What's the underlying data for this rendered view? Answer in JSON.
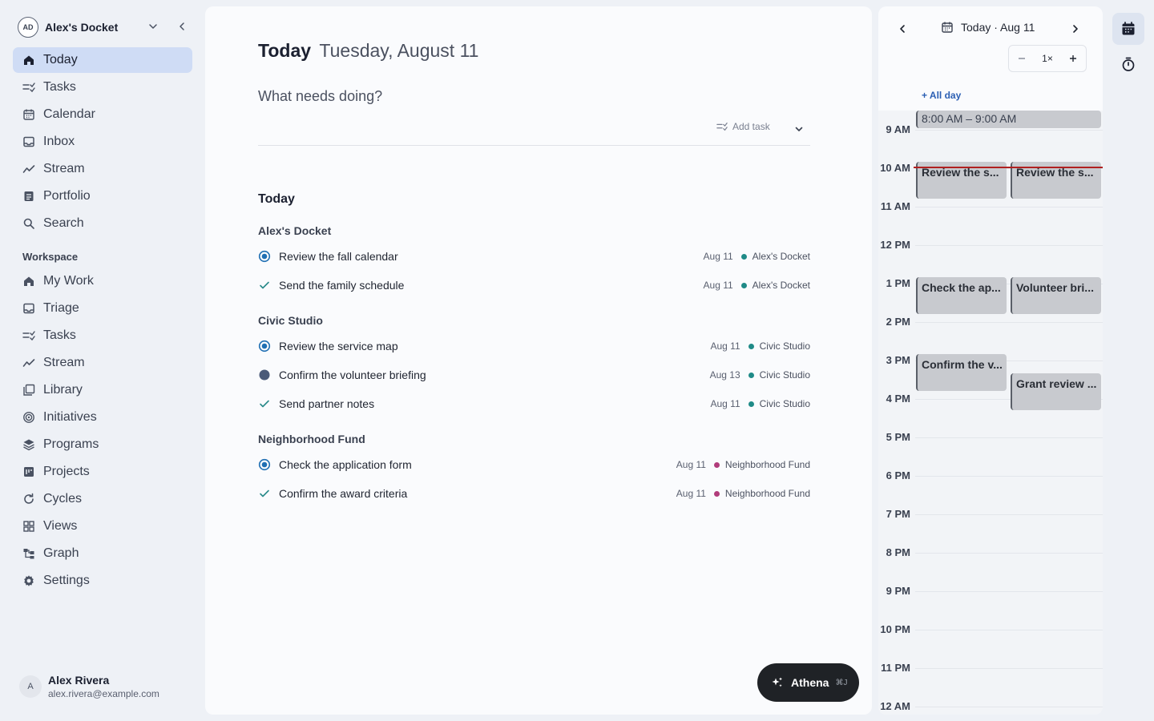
{
  "workspace": {
    "initials": "AD",
    "name": "Alex's Docket"
  },
  "nav": [
    {
      "label": "Today",
      "icon": "home-icon",
      "active": true
    },
    {
      "label": "Tasks",
      "icon": "tasks-icon"
    },
    {
      "label": "Calendar",
      "icon": "calendar-icon"
    },
    {
      "label": "Inbox",
      "icon": "inbox-icon"
    },
    {
      "label": "Stream",
      "icon": "stream-icon"
    },
    {
      "label": "Portfolio",
      "icon": "portfolio-icon"
    },
    {
      "label": "Search",
      "icon": "search-icon"
    }
  ],
  "workspace_section": {
    "title": "Workspace",
    "items": [
      {
        "label": "My Work",
        "icon": "home-icon"
      },
      {
        "label": "Triage",
        "icon": "inbox-icon"
      },
      {
        "label": "Tasks",
        "icon": "tasks-icon"
      },
      {
        "label": "Stream",
        "icon": "stream-icon"
      },
      {
        "label": "Library",
        "icon": "library-icon"
      },
      {
        "label": "Initiatives",
        "icon": "initiatives-icon"
      },
      {
        "label": "Programs",
        "icon": "programs-icon"
      },
      {
        "label": "Projects",
        "icon": "projects-icon"
      },
      {
        "label": "Cycles",
        "icon": "cycles-icon"
      },
      {
        "label": "Views",
        "icon": "views-icon"
      },
      {
        "label": "Graph",
        "icon": "graph-icon"
      },
      {
        "label": "Settings",
        "icon": "gear-icon"
      }
    ]
  },
  "user": {
    "initial": "A",
    "name": "Alex Rivera",
    "email": "alex.rivera@example.com"
  },
  "main": {
    "title": "Today",
    "date": "Tuesday, August 11",
    "prompt": "What needs doing?",
    "add_task": "Add task",
    "list_title": "Today",
    "groups": [
      {
        "name": "Alex's Docket",
        "tasks": [
          {
            "title": "Review the fall calendar",
            "status": "in-progress",
            "date": "Aug 11",
            "project": "Alex's Docket",
            "project_color": "#1f8a87"
          },
          {
            "title": "Send the family schedule",
            "status": "done",
            "date": "Aug 11",
            "project": "Alex's Docket",
            "project_color": "#1f8a87"
          }
        ]
      },
      {
        "name": "Civic Studio",
        "tasks": [
          {
            "title": "Review the service map",
            "status": "in-progress",
            "date": "Aug 11",
            "project": "Civic Studio",
            "project_color": "#1f8a87"
          },
          {
            "title": "Confirm the volunteer briefing",
            "status": "todo-filled",
            "date": "Aug 13",
            "project": "Civic Studio",
            "project_color": "#1f8a87"
          },
          {
            "title": "Send partner notes",
            "status": "done",
            "date": "Aug 11",
            "project": "Civic Studio",
            "project_color": "#1f8a87"
          }
        ]
      },
      {
        "name": "Neighborhood Fund",
        "tasks": [
          {
            "title": "Check the application form",
            "status": "in-progress",
            "date": "Aug 11",
            "project": "Neighborhood Fund",
            "project_color": "#b13c7b"
          },
          {
            "title": "Confirm the award criteria",
            "status": "done",
            "date": "Aug 11",
            "project": "Neighborhood Fund",
            "project_color": "#b13c7b"
          }
        ]
      }
    ]
  },
  "athena": {
    "label": "Athena",
    "shortcut": "⌘J"
  },
  "calendar": {
    "today_label": "Today · Aug 11",
    "zoom": "1×",
    "all_day": "+ All day",
    "hours": [
      "9 AM",
      "10 AM",
      "11 AM",
      "12 PM",
      "1 PM",
      "2 PM",
      "3 PM",
      "4 PM",
      "5 PM",
      "6 PM",
      "7 PM",
      "8 PM",
      "9 PM",
      "10 PM",
      "11 PM",
      "12 AM"
    ],
    "events": [
      {
        "label": "8:00 AM – 9:00 AM",
        "start": 8.0,
        "end": 9.0,
        "column": "full",
        "style": "light"
      },
      {
        "label": "Review the s...",
        "start": 10.0,
        "end": 11.0,
        "column": "left"
      },
      {
        "label": "Review the s...",
        "start": 10.0,
        "end": 11.0,
        "column": "right"
      },
      {
        "label": "Check the ap...",
        "start": 13.0,
        "end": 14.0,
        "column": "left"
      },
      {
        "label": "Volunteer bri...",
        "start": 13.0,
        "end": 14.0,
        "column": "right"
      },
      {
        "label": "Confirm the v...",
        "start": 15.0,
        "end": 16.0,
        "column": "left"
      },
      {
        "label": "Grant review ...",
        "start": 15.5,
        "end": 16.5,
        "column": "right"
      }
    ],
    "now_hour": 10.0,
    "colors": {
      "now_line": "#b02020",
      "event_bg": "#c8cacf"
    }
  },
  "rail": [
    {
      "icon": "calendar-icon",
      "active": true
    },
    {
      "icon": "timer-icon",
      "active": false
    }
  ],
  "colors": {
    "active_nav": "#cfdcf5",
    "accent_blue": "#1f6fb3",
    "done_check": "#2a8a8a"
  }
}
